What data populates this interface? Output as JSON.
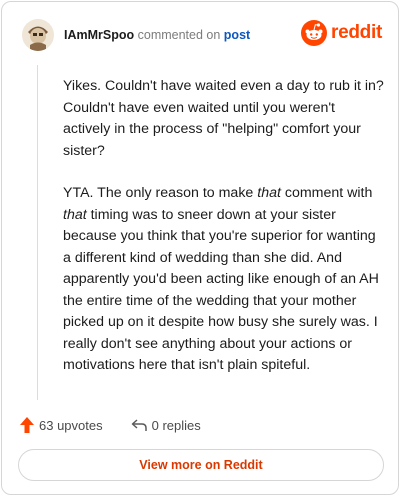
{
  "header": {
    "username": "IAmMrSpoo",
    "commented_on": "commented on",
    "post_link": "post",
    "brand": "reddit",
    "avatar_icon": "snoo-avatar-icon",
    "brand_icon": "reddit-alien-logo-icon",
    "brand_color": "#ff4500"
  },
  "comment": {
    "paragraph1": "Yikes. Couldn't have waited even a day to rub it in? Couldn't have even waited until you weren't actively in the process of \"helping\" comfort your sister?",
    "p2": {
      "a": "YTA. The only reason to make ",
      "b": "that",
      "c": " comment with ",
      "d": "that",
      "e": " timing was to sneer down at your sister because you think that you're superior for wanting a different kind of wedding than she did. And apparently you'd been acting like enough of an AH the entire time of the wedding that your mother picked up on it despite how busy she surely was. I really don't see anything about your actions or motivations here that isn't plain spiteful."
    }
  },
  "actions": {
    "upvotes": "63 upvotes",
    "replies": "0 replies",
    "upvote_icon": "upvote-arrow-icon",
    "reply_icon": "reply-arrow-icon",
    "upvote_color": "#ff4500"
  },
  "footer": {
    "view_more": "View more on Reddit"
  }
}
